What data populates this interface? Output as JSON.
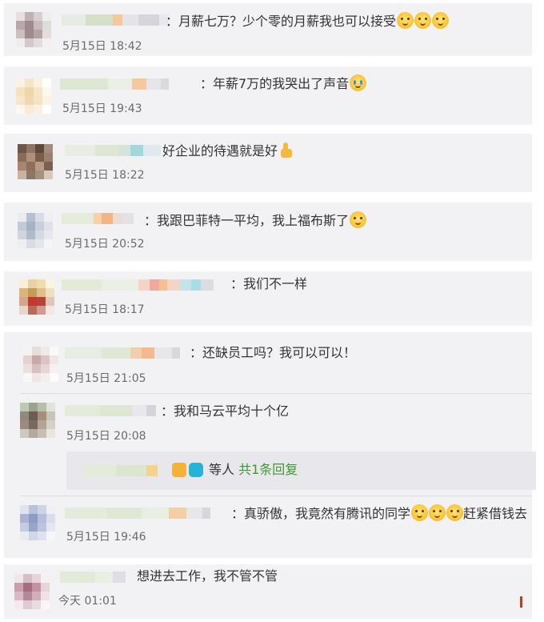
{
  "comments": [
    {
      "text": "：月薪七万？少个零的月薪我也可以接受",
      "emoji": [
        "emoji-dog",
        "emoji-dog",
        "emoji-dog"
      ],
      "time": "5月15日 18:42"
    },
    {
      "text": "：年薪7万的我哭出了声音",
      "emoji": [
        "emoji-crying"
      ],
      "time": "5月15日 19:43"
    },
    {
      "text": "好企业的待遇就是好",
      "emoji": [
        "thumbs-up"
      ],
      "time": "5月15日 18:22"
    },
    {
      "text": "：我跟巴菲特一平均，我上福布斯了",
      "emoji": [
        "emoji-dog"
      ],
      "time": "5月15日 20:52"
    },
    {
      "text": "：我们不一样",
      "emoji": [],
      "time": "5月15日 18:17"
    },
    {
      "text": "：还缺员工吗？我可以可以！",
      "emoji": [],
      "time": "5月15日 21:05"
    },
    {
      "text": "：我和马云平均十个亿",
      "emoji": [],
      "time": "5月15日 20:08"
    },
    {
      "text": "：真骄傲，我竟然有腾讯的同学",
      "text_after": "赶紧借钱去",
      "emoji": [
        "emoji-dog",
        "emoji-dog",
        "emoji-dog"
      ],
      "time": "5月15日 19:46"
    },
    {
      "text": "想进去工作，我不管不管",
      "emoji": [],
      "time": "今天 01:01"
    }
  ],
  "reply_summary": {
    "prefix": "等人",
    "link": "共1条回复"
  },
  "colors": {
    "card_bg": "#f2f2f5",
    "reply_link": "#3e9a2e",
    "time_text": "#6b6b6b"
  }
}
